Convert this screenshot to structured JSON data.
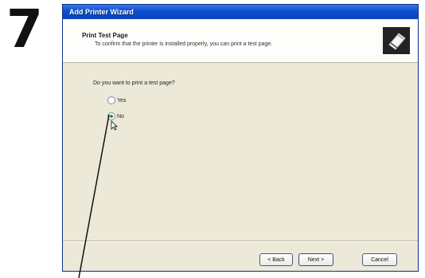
{
  "step": {
    "number": "7"
  },
  "window": {
    "title": "Add Printer Wizard"
  },
  "header": {
    "title": "Print Test Page",
    "subtitle": "To confirm that the printer is installed properly, you can print a test page."
  },
  "question": {
    "text": "Do you want to print a test page?"
  },
  "options": [
    {
      "label": "Yes",
      "selected": false
    },
    {
      "label": "No",
      "selected": true
    }
  ],
  "buttons": {
    "back": "< Back",
    "next": "Next >",
    "cancel": "Cancel"
  },
  "icons": {
    "printer": "printer-icon",
    "cursor": "mouse-pointer-icon"
  },
  "colors": {
    "titlebar": "#0c4fcf",
    "window_bg": "#ece9d8"
  }
}
